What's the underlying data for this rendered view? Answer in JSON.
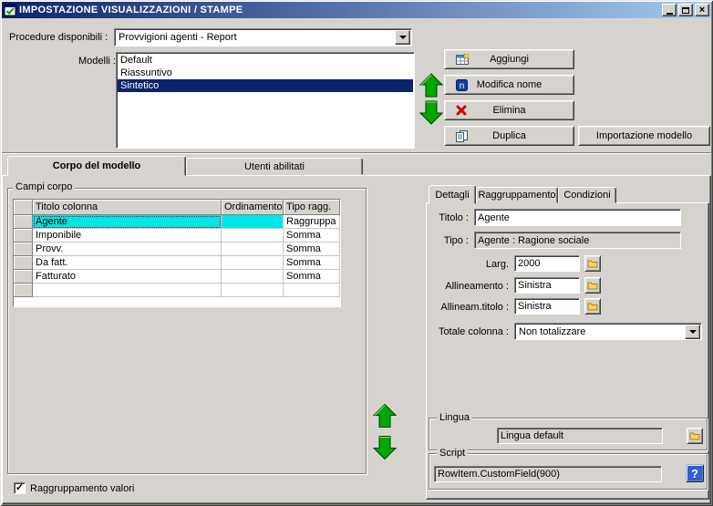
{
  "colors": {
    "titlebar_start": "#0a246a",
    "titlebar_end": "#a6caf0",
    "list_selection": "#0a246a",
    "grid_selection": "#00e6e6",
    "arrow_green": "#00a800",
    "remove_orange": "#ff7a00",
    "window_bg": "#d6d3ce"
  },
  "window": {
    "title": "IMPOSTAZIONE VISUALIZZAZIONI / STAMPE",
    "close_glyph": "×"
  },
  "top": {
    "procedure_label": "Procedure disponibili :",
    "procedure_value": "Provvigioni agenti - Report",
    "modelli_label": "Modelli :",
    "modelli_items": [
      "Default",
      "Riassuntivo",
      "Sintetico"
    ],
    "buttons": {
      "aggiungi": "Aggiungi",
      "modifica_nome": "Modifica nome",
      "elimina": "Elimina",
      "duplica": "Duplica",
      "importazione": "Importazione modello"
    }
  },
  "tabs": {
    "corpo": "Corpo del modello",
    "utenti": "Utenti abilitati"
  },
  "campi": {
    "group_label": "Campi corpo",
    "headers": [
      "Titolo colonna",
      "Ordinamento",
      "Tipo ragg."
    ],
    "rows": [
      {
        "titolo": "Agente",
        "ordinamento": "",
        "tipo": "Raggruppa"
      },
      {
        "titolo": "Imponibile",
        "ordinamento": "",
        "tipo": "Somma"
      },
      {
        "titolo": "Provv.",
        "ordinamento": "",
        "tipo": "Somma"
      },
      {
        "titolo": "Da fatt.",
        "ordinamento": "",
        "tipo": "Somma"
      },
      {
        "titolo": "Fatturato",
        "ordinamento": "",
        "tipo": "Somma"
      }
    ],
    "aggiungi_campo": "Aggiungi campo",
    "rimuovi_campo": "Rimuovi campo"
  },
  "dettagli": {
    "tab_dettagli": "Dettagli",
    "tab_raggruppamento": "Raggruppamento",
    "tab_condizioni": "Condizioni",
    "titolo_label": "Titolo :",
    "titolo_value": "Agente",
    "tipo_label": "Tipo :",
    "tipo_value": "Agente : Ragione sociale",
    "larg_label": "Larg.",
    "larg_value": "2000",
    "allineamento_label": "Allineamento :",
    "allineamento_value": "Sinistra",
    "allineam_titolo_label": "Allineam.titolo :",
    "allineam_titolo_value": "Sinistra",
    "totale_label": "Totale colonna :",
    "totale_value": "Non totalizzare",
    "lingua_group": "Lingua",
    "lingua_value": "Lingua default",
    "script_group": "Script",
    "script_value": "RowItem.CustomField(900)",
    "help_glyph": "?"
  },
  "footer": {
    "raggruppamento_label": "Raggruppamento valori",
    "check_glyph": "✓"
  }
}
